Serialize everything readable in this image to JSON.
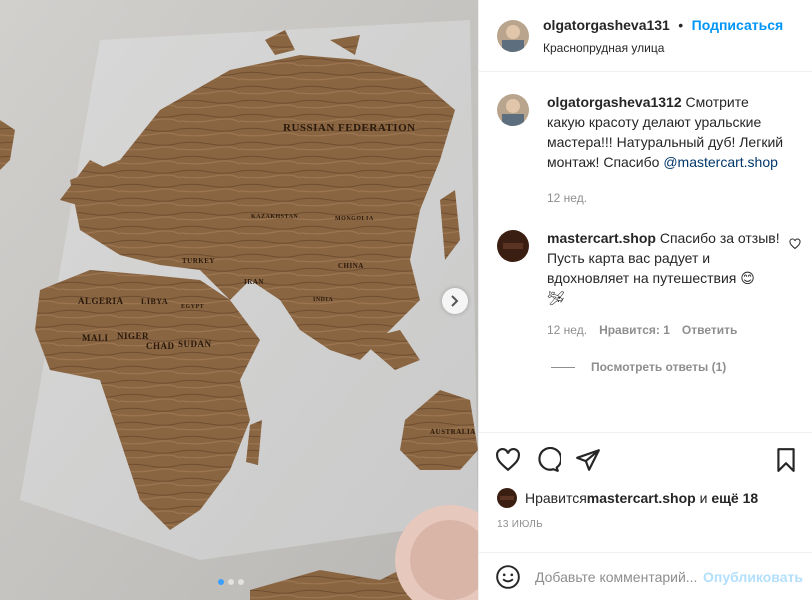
{
  "post": {
    "username": "olgatorgasheva131",
    "separator": "•",
    "follow_label": "Подписаться",
    "location": "Краснопрудная улица",
    "carousel": {
      "slide_count": 3,
      "active_index": 0
    }
  },
  "map_labels": {
    "russia": "RUSSIAN FEDERATION",
    "kazakhstan": "KAZAKHSTAN",
    "mongolia": "MONGOLIA",
    "turkey": "TURKEY",
    "iran": "IRAN",
    "china": "CHINA",
    "india": "INDIA",
    "algeria": "ALGERIA",
    "libya": "LIBYA",
    "egypt": "EGYPT",
    "mali": "MALI",
    "niger": "NIGER",
    "chad": "CHAD",
    "sudan": "SUDAN",
    "australia": "AUSTRALIA"
  },
  "comments": [
    {
      "author": "olgatorgasheva1312",
      "text_before": " Смотрите какую красоту делают уральские мастера!!! Натуральный дуб! Легкий монтаж! Спасибо ",
      "mention": "@mastercart.shop",
      "time": "12 нед."
    },
    {
      "author": "mastercart.shop",
      "text": " Спасибо за отзыв! Пусть карта вас радует и вдохновляет на путешествия 😊",
      "emoji_line": "🛩",
      "time": "12 нед.",
      "likes": "Нравится: 1",
      "reply_label": "Ответить",
      "view_replies": "Посмотреть ответы (1)"
    }
  ],
  "likes": {
    "prefix": "Нравится ",
    "user": "mastercart.shop",
    "middle": " и ",
    "more": "ещё 18"
  },
  "date": "13 ИЮЛЬ",
  "composer": {
    "placeholder": "Добавьте комментарий...",
    "publish_label": "Опубликовать"
  },
  "icons": {
    "like": "heart-icon",
    "comment": "comment-icon",
    "share": "paper-plane-icon",
    "save": "bookmark-icon",
    "emoji": "smiley-icon",
    "next": "chevron-right-icon"
  }
}
